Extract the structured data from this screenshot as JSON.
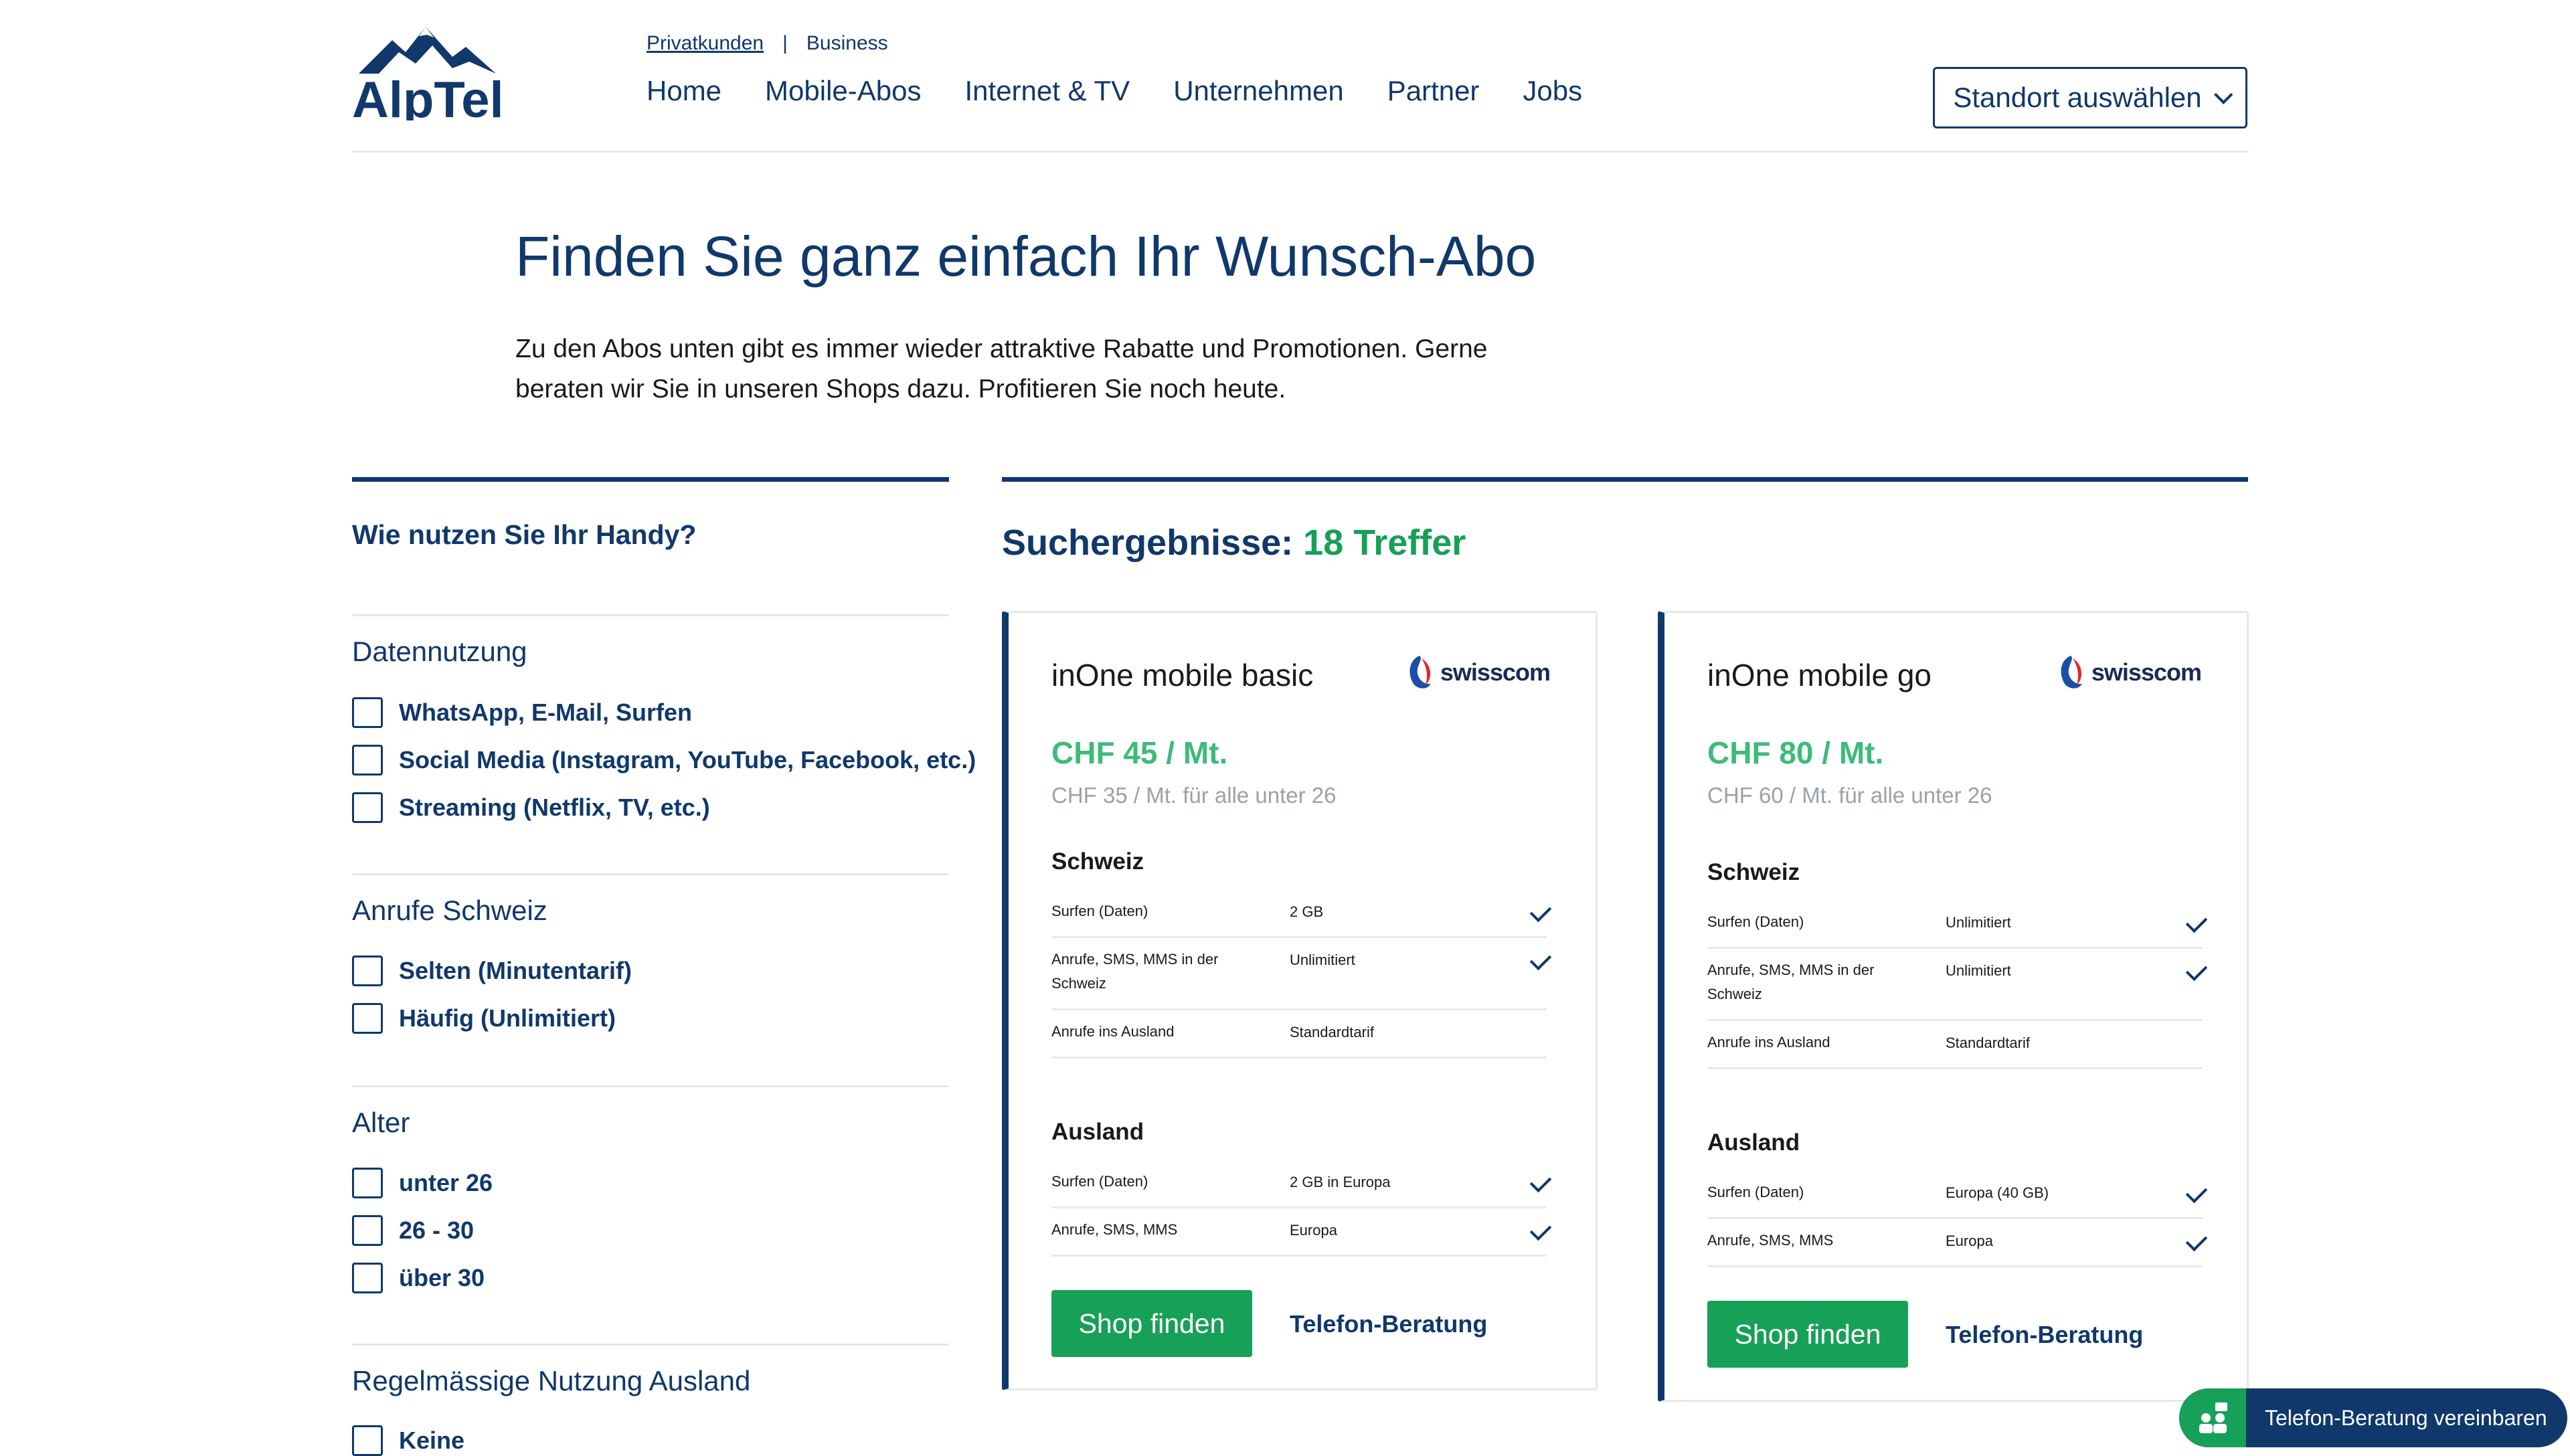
{
  "header": {
    "logo_text": "AlpTel",
    "top_links": [
      "Privatkunden",
      "Business"
    ],
    "nav": [
      "Home",
      "Mobile-Abos",
      "Internet & TV",
      "Unternehmen",
      "Partner",
      "Jobs"
    ],
    "location_button": "Standort auswählen"
  },
  "hero": {
    "title": "Finden Sie ganz einfach Ihr Wunsch-Abo",
    "text": "Zu den Abos unten gibt es immer wieder attraktive Rabatte und Promotionen. Gerne beraten wir Sie in unseren Shops dazu. Profitieren Sie noch heute."
  },
  "filters": {
    "question": "Wie nutzen Sie Ihr Handy?",
    "groups": [
      {
        "title": "Datennutzung",
        "options": [
          "WhatsApp, E-Mail, Surfen",
          "Social Media (Instagram, YouTube, Facebook, etc.)",
          "Streaming (Netflix, TV, etc.)"
        ]
      },
      {
        "title": "Anrufe Schweiz",
        "options": [
          "Selten (Minutentarif)",
          "Häufig (Unlimitiert)"
        ]
      },
      {
        "title": "Alter",
        "options": [
          "unter 26",
          "26 - 30",
          "über 30"
        ]
      },
      {
        "title": "Regelmässige Nutzung Ausland",
        "options": [
          "Keine"
        ]
      }
    ]
  },
  "results": {
    "label": "Suchergebnisse:",
    "count": "18 Treffer"
  },
  "cards": [
    {
      "name": "inOne mobile basic",
      "brand": "swisscom",
      "price": "CHF 45 / Mt.",
      "youth_price": "CHF 35 / Mt. für alle unter 26",
      "schweiz_title": "Schweiz",
      "schweiz": [
        {
          "k": "Surfen (Daten)",
          "v": "2 GB",
          "check": "orange"
        },
        {
          "k": "Anrufe, SMS, MMS in der Schweiz",
          "v": "Unlimitiert",
          "check": "green"
        },
        {
          "k": "Anrufe ins Ausland",
          "v": "Standardtarif",
          "check": ""
        }
      ],
      "ausland_title": "Ausland",
      "ausland": [
        {
          "k": "Surfen (Daten)",
          "v": "2 GB in Europa",
          "check": "orange"
        },
        {
          "k": "Anrufe, SMS, MMS",
          "v": "Europa",
          "check": "green"
        }
      ],
      "shop_button": "Shop finden",
      "tel_link": "Telefon-Beratung"
    },
    {
      "name": "inOne mobile go",
      "brand": "swisscom",
      "price": "CHF 80 / Mt.",
      "youth_price": "CHF 60 / Mt. für alle unter 26",
      "schweiz_title": "Schweiz",
      "schweiz": [
        {
          "k": "Surfen (Daten)",
          "v": "Unlimitiert",
          "check": "green"
        },
        {
          "k": "Anrufe, SMS, MMS in der Schweiz",
          "v": "Unlimitiert",
          "check": "green"
        },
        {
          "k": "Anrufe ins Ausland",
          "v": "Standardtarif",
          "check": ""
        }
      ],
      "ausland_title": "Ausland",
      "ausland": [
        {
          "k": "Surfen (Daten)",
          "v": "Europa (40 GB)",
          "check": "green"
        },
        {
          "k": "Anrufe, SMS, MMS",
          "v": "Europa",
          "check": "green"
        }
      ],
      "shop_button": "Shop finden",
      "tel_link": "Telefon-Beratung"
    }
  ],
  "cta": {
    "label": "Telefon-Beratung vereinbaren"
  },
  "colors": {
    "navy": "#10386b",
    "green": "#17a057",
    "light_green": "#3dbb79",
    "orange": "#f0a01e"
  },
  "icons": [
    "mountain-logo-icon",
    "chevron-down-icon",
    "swisscom-logo-icon",
    "check-icon",
    "people-phone-icon"
  ]
}
